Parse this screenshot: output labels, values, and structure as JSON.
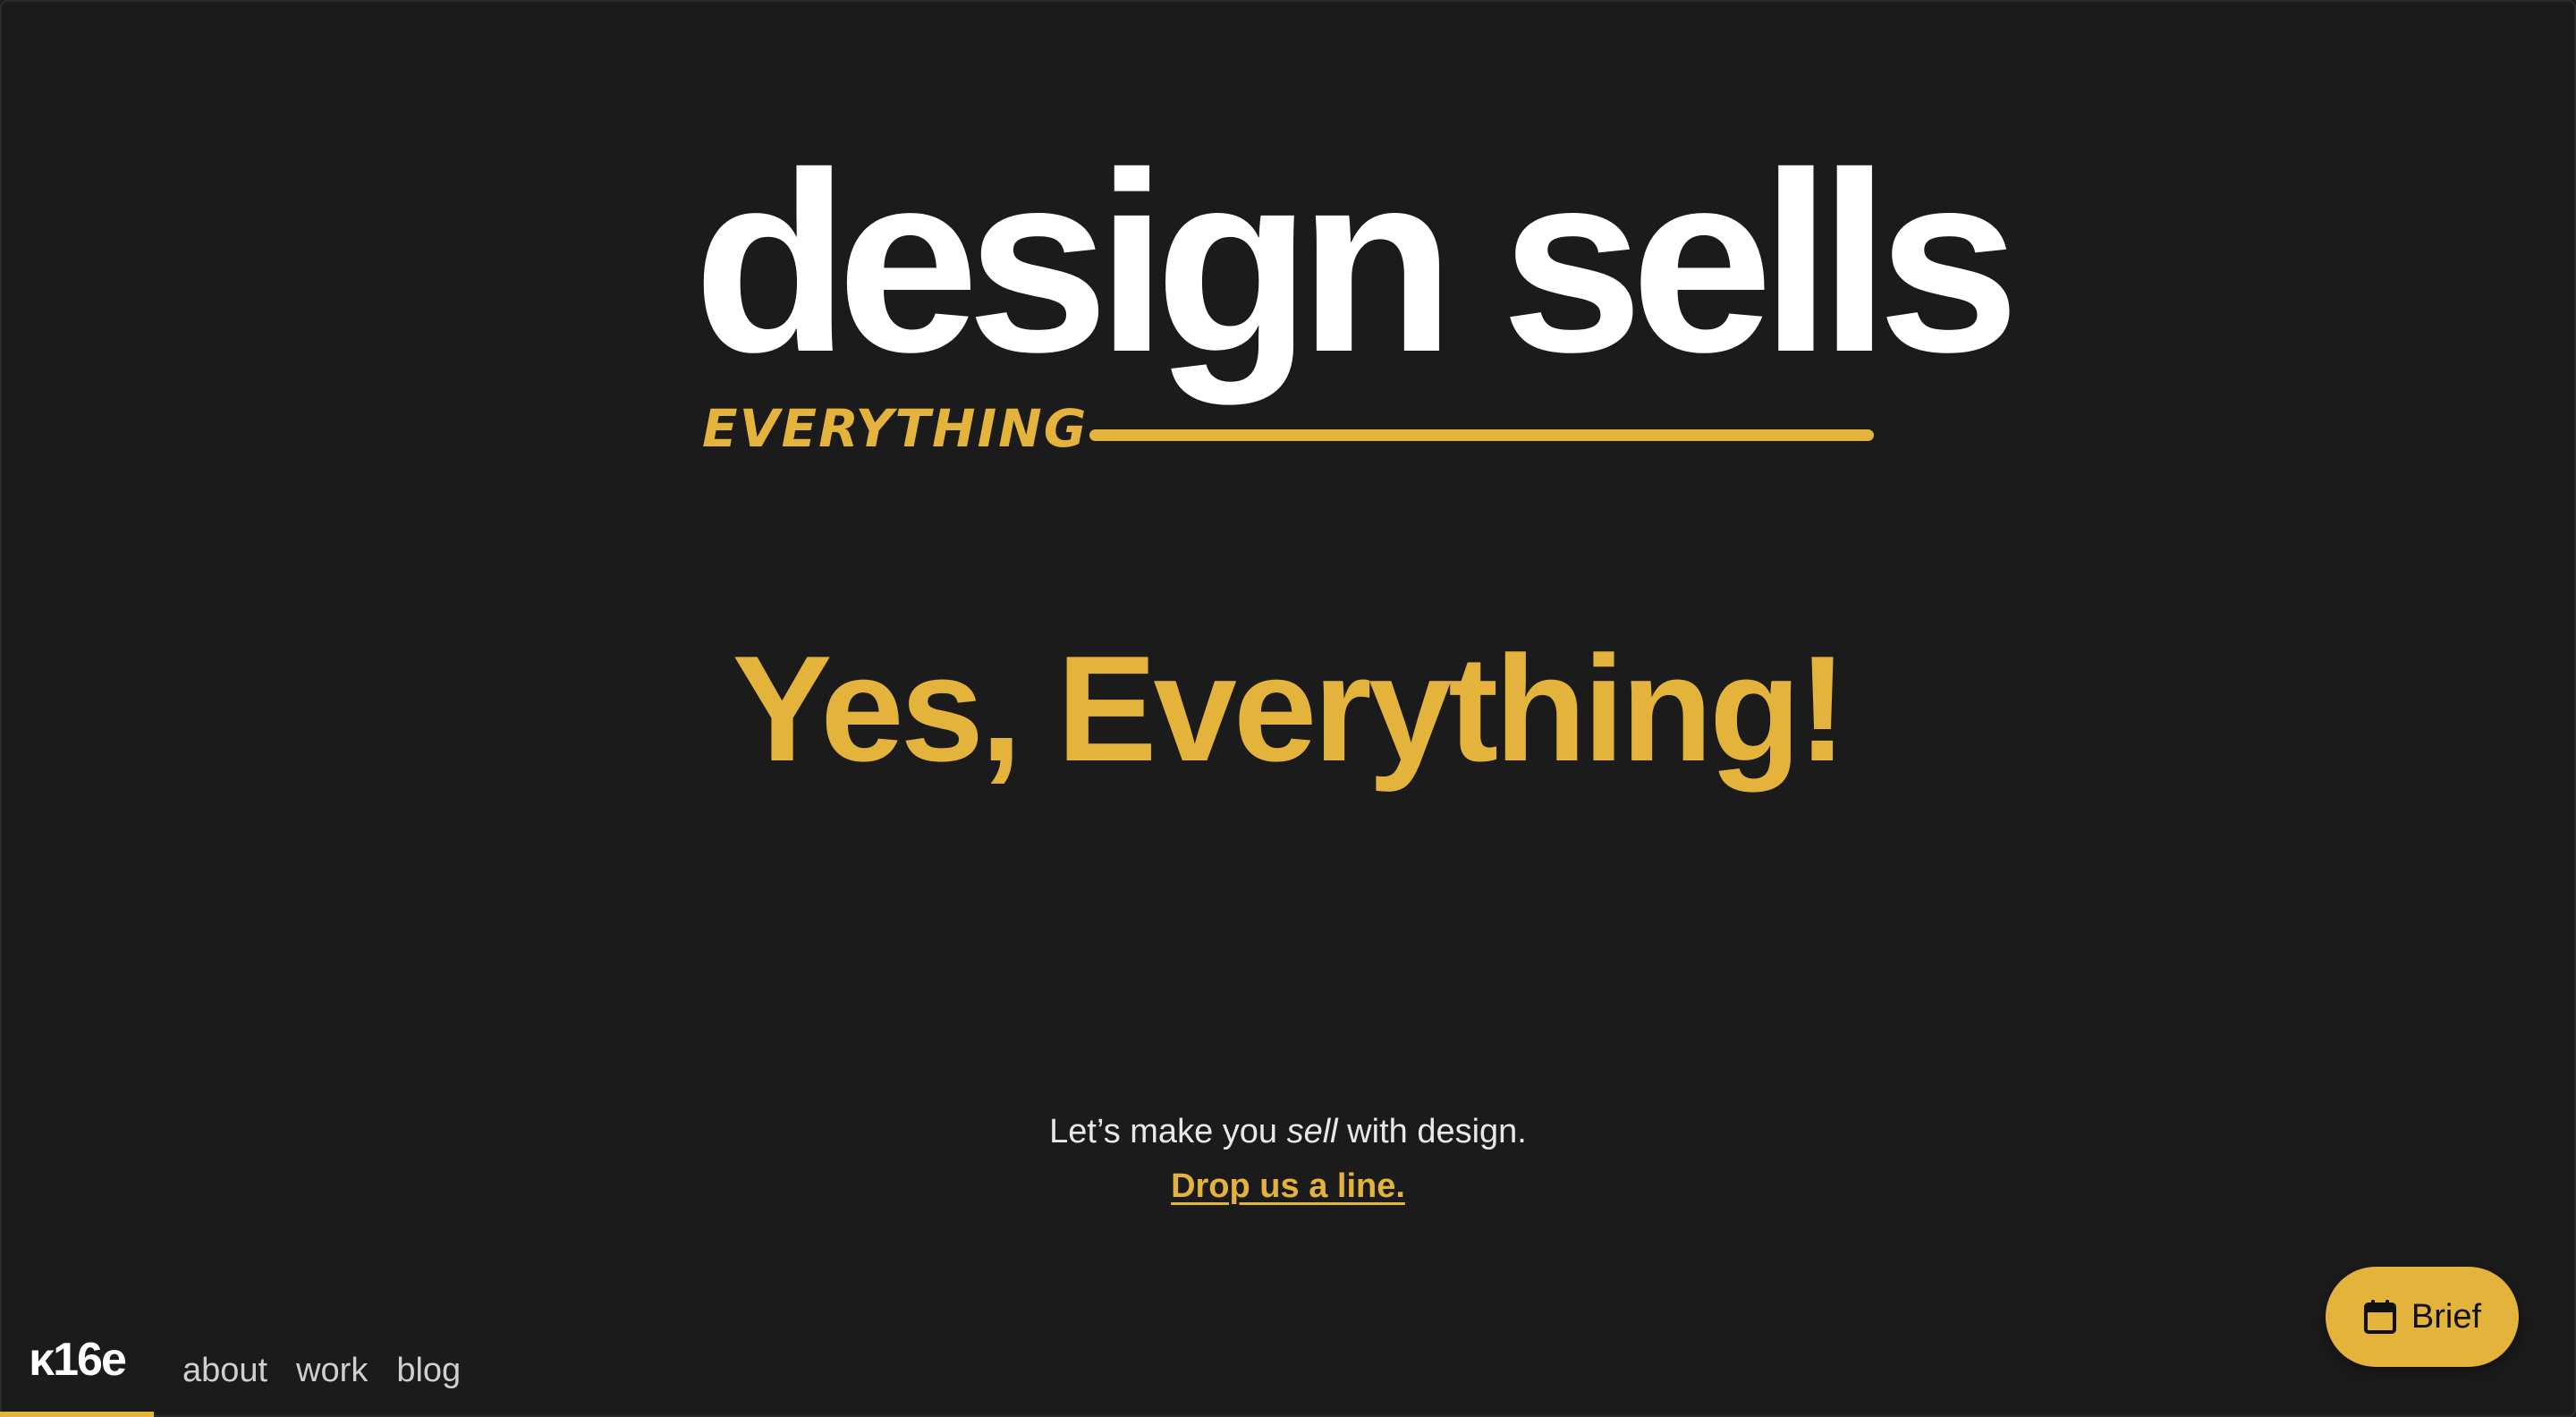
{
  "hero": {
    "title": "design sells",
    "subtitle": "EVERYTHING",
    "emphasis": "Yes, Everything!"
  },
  "cta": {
    "text_before": "Let’s make you ",
    "text_italic": "sell",
    "text_after": " with design.",
    "link_label": "Drop us a line."
  },
  "nav": {
    "logo": "κ16e",
    "links": [
      "about",
      "work",
      "blog"
    ]
  },
  "brief_button": {
    "label": "Brief",
    "icon": "calendar-icon"
  },
  "colors": {
    "background": "#1b1b1b",
    "accent": "#e4b33b",
    "text": "#ffffff"
  }
}
